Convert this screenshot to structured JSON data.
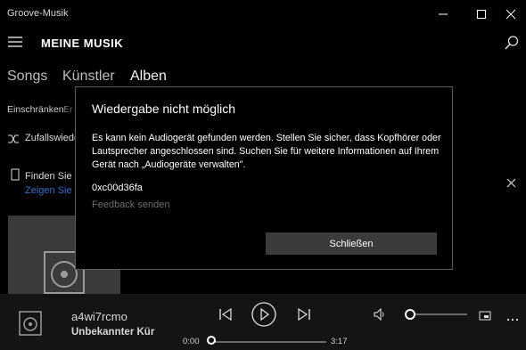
{
  "window": {
    "title": "Groove-Musik"
  },
  "header": {
    "title": "MEINE MUSIK"
  },
  "tabs": [
    "Songs",
    "Künstler",
    "Alben"
  ],
  "filter": {
    "label": "Einschränken:",
    "value": "Er"
  },
  "shuffle": {
    "label": "Zufallswiede"
  },
  "banner": {
    "title": "Finden Sie n",
    "link": "Zeigen Sie u"
  },
  "dialog": {
    "title": "Wiedergabe nicht möglich",
    "message": "Es kann kein Audiogerät gefunden werden. Stellen Sie sicher, dass Kopfhörer oder Lautsprecher angeschlossen sind. Suchen Sie für weitere Informationen auf Ihrem Gerät nach „Audiogeräte verwalten\".",
    "error_code": "0xc00d36fa",
    "feedback": "Feedback senden",
    "close_label": "Schließen"
  },
  "player": {
    "track_title": "a4wi7rcmo",
    "artist": "Unbekannter Kür",
    "time_current": "0:00",
    "time_total": "3:17",
    "progress": 0.0,
    "volume": 0.0
  },
  "colors": {
    "link": "#2d6fd1",
    "dialog_border": "#5c5c5c",
    "button_bg": "#3b3b3b"
  },
  "icons": [
    "hamburger-icon",
    "search-icon",
    "minimize-icon",
    "maximize-icon",
    "close-icon",
    "shuffle-icon",
    "device-icon",
    "dismiss-icon",
    "album-art-icon",
    "previous-icon",
    "play-icon",
    "next-icon",
    "volume-icon",
    "miniplayer-icon",
    "more-icon"
  ]
}
